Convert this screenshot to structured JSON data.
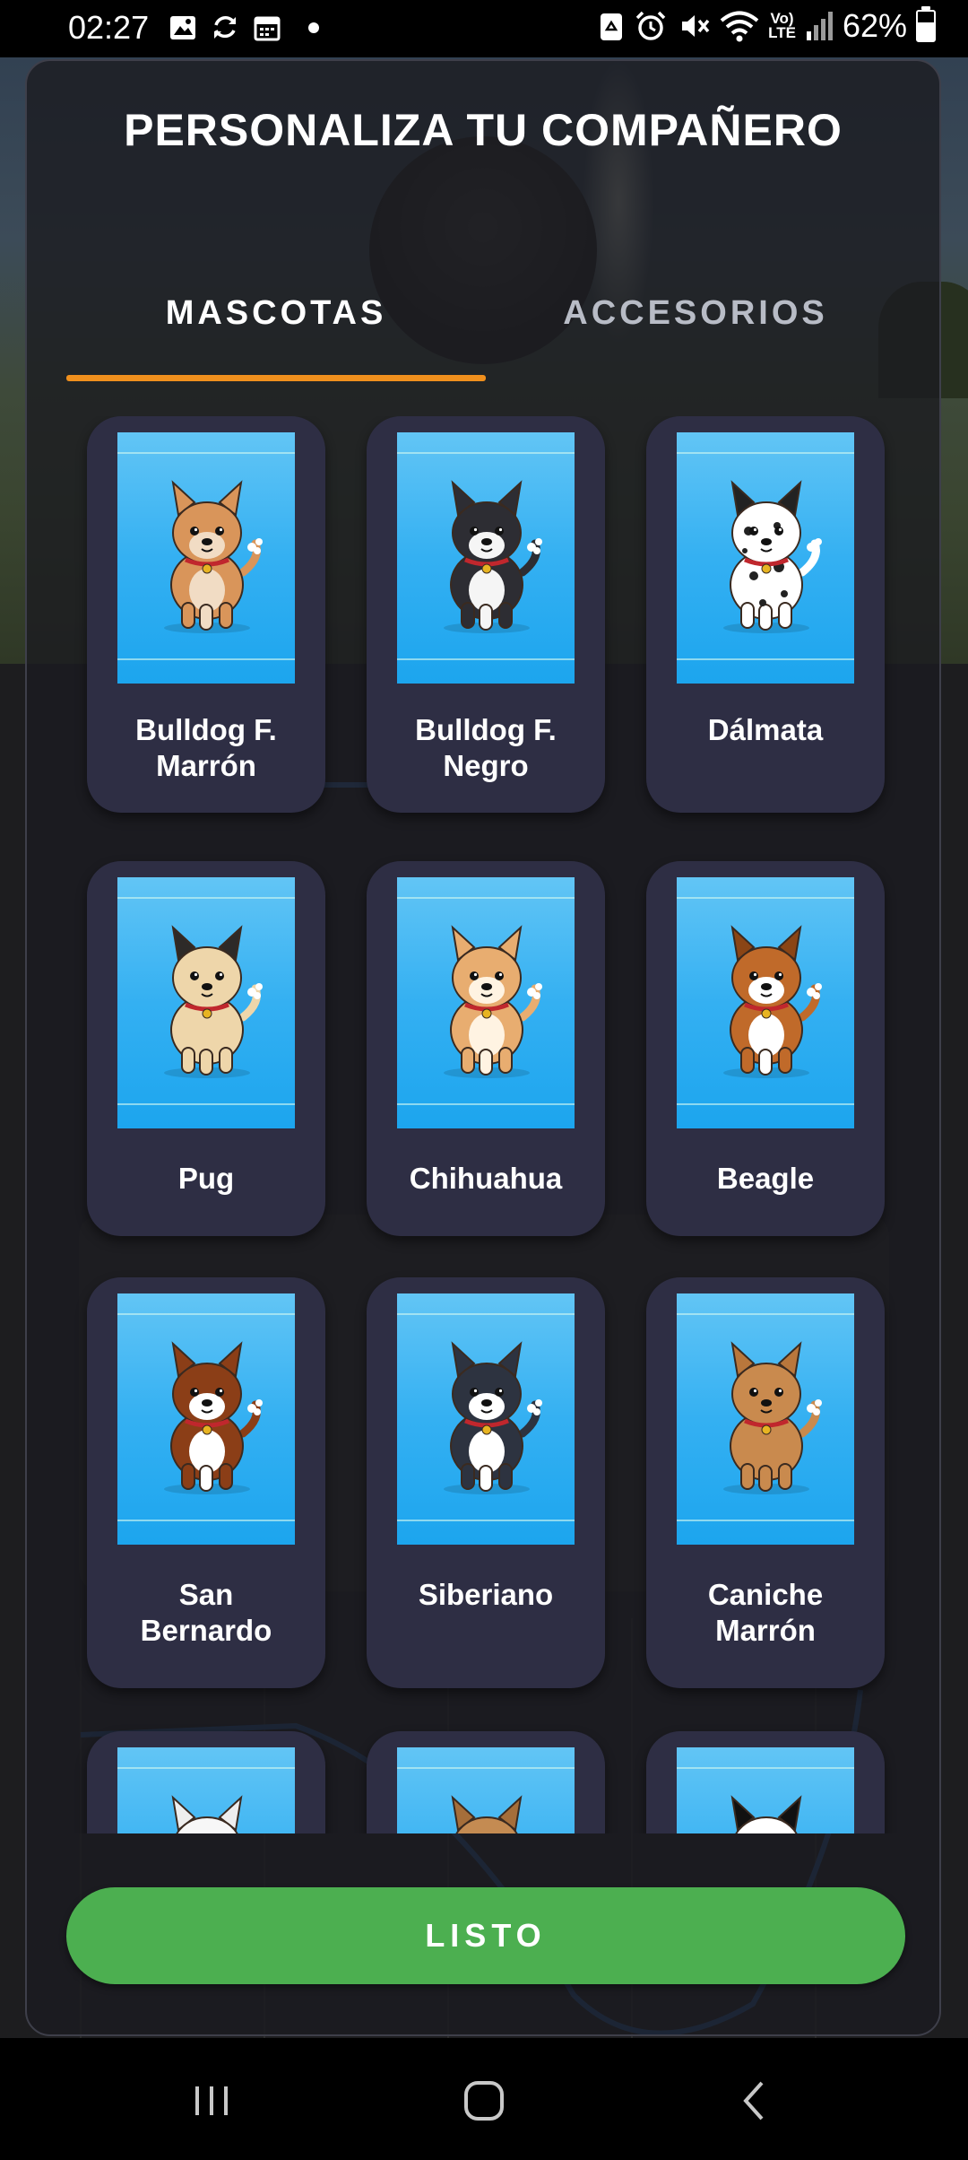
{
  "status_bar": {
    "time": "02:27",
    "battery": "62%",
    "battery_level": 0.62,
    "icons": [
      "image-icon",
      "sync-icon",
      "calendar-icon",
      "dot-icon",
      "recycle-icon",
      "alarm-icon",
      "mute-icon",
      "wifi-icon",
      "volte-icon",
      "signal-icon",
      "battery-icon"
    ],
    "volte_label": "Vo)\nLTE"
  },
  "modal": {
    "title": "PERSONALIZA TU COMPAÑERO",
    "tabs": [
      {
        "label": "MASCOTAS",
        "active": true
      },
      {
        "label": "ACCESORIOS",
        "active": false
      }
    ],
    "accent_color": "#f0901d",
    "pets": [
      {
        "name": "Bulldog F.\nMarrón",
        "icon": "brown-french-bulldog-icon",
        "body": "#d9955a",
        "accent": "#f1dcc4",
        "ears": "#d9955a"
      },
      {
        "name": "Bulldog F.\nNegro",
        "icon": "black-french-bulldog-icon",
        "body": "#2d2d33",
        "accent": "#f5f5f5",
        "ears": "#2d2d33"
      },
      {
        "name": "Dálmata",
        "icon": "dalmatian-icon",
        "body": "#ffffff",
        "accent": "#ffffff",
        "ears": "#222222"
      },
      {
        "name": "Pug",
        "icon": "pug-icon",
        "body": "#eed6aa",
        "accent": "#eed6aa",
        "ears": "#2d2a28"
      },
      {
        "name": "Chihuahua",
        "icon": "chihuahua-icon",
        "body": "#e8ad70",
        "accent": "#fff3e2",
        "ears": "#e8ad70"
      },
      {
        "name": "Beagle",
        "icon": "beagle-icon",
        "body": "#c06a2a",
        "accent": "#ffffff",
        "ears": "#8a4515"
      },
      {
        "name": "San\nBernardo",
        "icon": "saint-bernard-icon",
        "body": "#8b3e17",
        "accent": "#ffffff",
        "ears": "#8b3e17"
      },
      {
        "name": "Siberiano",
        "icon": "siberian-husky-icon",
        "body": "#2d3340",
        "accent": "#ffffff",
        "ears": "#2d3340"
      },
      {
        "name": "Caniche\nMarrón",
        "icon": "brown-poodle-icon",
        "body": "#c98a4e",
        "accent": "#c98a4e",
        "ears": "#b9773c"
      },
      {
        "name": "",
        "icon": "white-poodle-icon",
        "body": "#f7f7f7",
        "accent": "#f7f7f7",
        "ears": "#eeeeee"
      },
      {
        "name": "",
        "icon": "shar-pei-icon",
        "body": "#c48b52",
        "accent": "#c48b52",
        "ears": "#a56e3a"
      },
      {
        "name": "",
        "icon": "panda-icon",
        "body": "#ffffff",
        "accent": "#ffffff",
        "ears": "#111111"
      }
    ],
    "done_button": "LISTO",
    "done_color": "#4caf50"
  },
  "nav_bar": {
    "icons": [
      "recent-apps-icon",
      "home-icon",
      "back-icon"
    ]
  }
}
